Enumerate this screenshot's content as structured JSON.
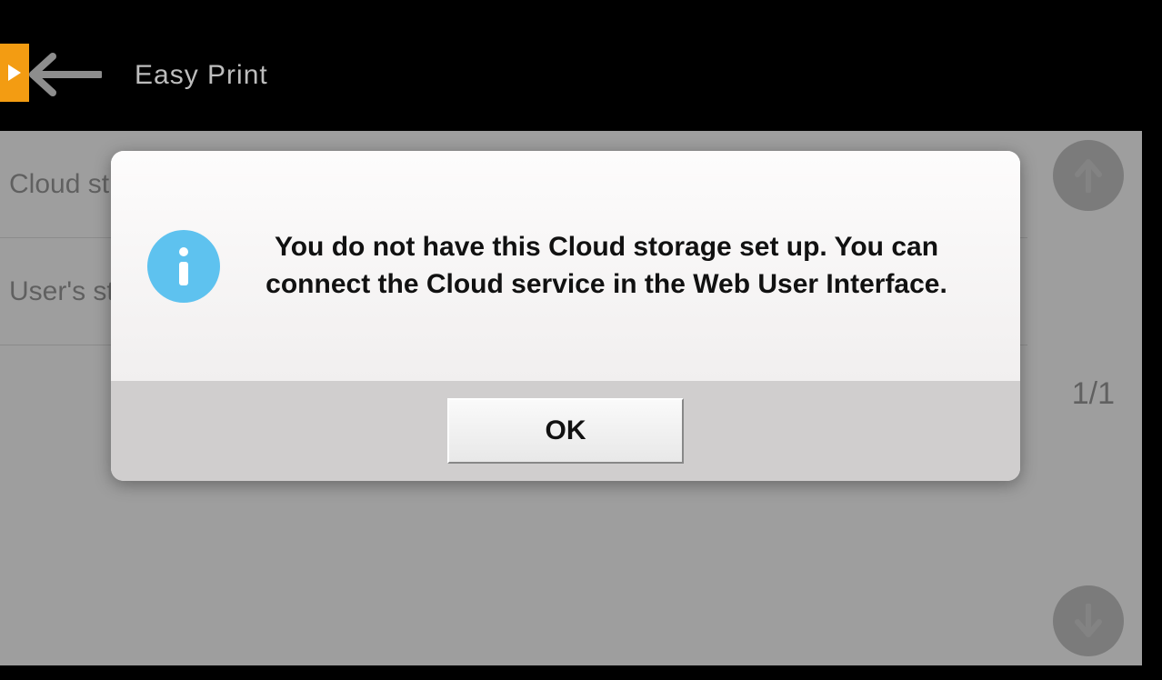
{
  "header": {
    "title": "Easy Print"
  },
  "list": {
    "row1": "Cloud st",
    "row2": "User's st"
  },
  "pagination": {
    "indicator": "1/1"
  },
  "dialog": {
    "message": "You do not have this Cloud storage set up. You can connect the Cloud service in the Web User Interface.",
    "ok_label": "OK"
  }
}
